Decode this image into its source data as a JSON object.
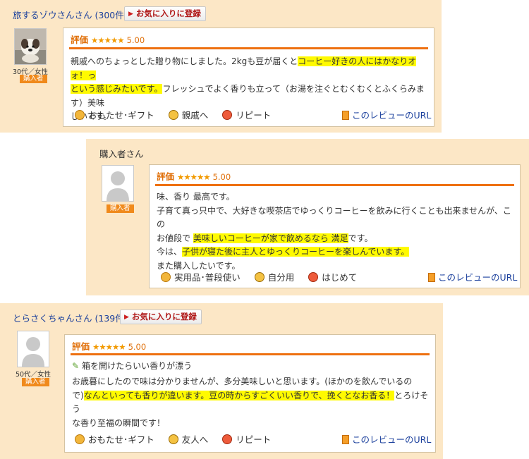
{
  "reviews": [
    {
      "reviewer": "旅するゾウさんさん",
      "count": "(300件)",
      "fav_label": "お気に入りに登録",
      "age_gender": "30代／女性",
      "badge": "購入者",
      "rating_label": "評価",
      "stars": "★★★★★",
      "score": "5.00",
      "body": [
        [
          {
            "t": "親戚へのちょっとした贈り物にしました。2kgも豆が届くと"
          },
          {
            "t": "コーヒー好きの人にはかなりオォ！っ",
            "h": true
          }
        ],
        [
          {
            "t": "という感じみたいです。",
            "h": true
          },
          {
            "t": "フレッシュでよく香りも立って（お湯を注ぐとむくむくとふくらみます）美味"
          }
        ],
        [
          {
            "t": "しいです。"
          }
        ]
      ],
      "tags": [
        {
          "icon": "hand-icon",
          "label": "おもたせ･ギフト"
        },
        {
          "icon": "person-icon",
          "label": "親戚へ"
        },
        {
          "icon": "repeat-icon",
          "label": "リピート"
        }
      ],
      "url_label": "このレビューのURL"
    },
    {
      "reviewer": "購入者さん",
      "badge": "購入者",
      "rating_label": "評価",
      "stars": "★★★★★",
      "score": "5.00",
      "body": [
        [
          {
            "t": "味、香り 最高です。"
          }
        ],
        [
          {
            "t": "子育て真っ只中で、大好きな喫茶店でゆっくりコーヒーを飲みに行くことも出来ませんが、この"
          }
        ],
        [
          {
            "t": "お値段で "
          },
          {
            "t": "美味しいコーヒーが家で飲めるなら 満足",
            "h": true
          },
          {
            "t": "です。"
          }
        ],
        [
          {
            "t": "今は、"
          },
          {
            "t": "子供が寝た後に主人とゆっくりコーヒーを楽しんでいます。",
            "h": true
          }
        ],
        [
          {
            "t": "また購入したいです。"
          }
        ]
      ],
      "tags": [
        {
          "icon": "hand-icon",
          "label": "実用品･普段使い"
        },
        {
          "icon": "person-icon",
          "label": "自分用"
        },
        {
          "icon": "repeat-icon",
          "label": "はじめて"
        }
      ],
      "url_label": "このレビューのURL"
    },
    {
      "reviewer": "とらさくちゃんさん",
      "count": "(139件)",
      "fav_label": "お気に入りに登録",
      "age_gender": "50代／女性",
      "badge": "購入者",
      "rating_label": "評価",
      "stars": "★★★★★",
      "score": "5.00",
      "title": "箱を開けたらいい香りが漂う",
      "body": [
        [
          {
            "t": "お歳暮にしたので味は分かりませんが、多分美味しいと思います。(ほかのを飲んでいるの"
          }
        ],
        [
          {
            "t": "で)"
          },
          {
            "t": "なんといっても香りが違います。豆の時からすごくいい香りで、挽くとなお香る！",
            "h": true
          },
          {
            "t": "とろけそう"
          }
        ],
        [
          {
            "t": "な香り至福の瞬間です！"
          }
        ]
      ],
      "tags": [
        {
          "icon": "hand-icon",
          "label": "おもたせ･ギフト"
        },
        {
          "icon": "person-icon",
          "label": "友人へ"
        },
        {
          "icon": "repeat-icon",
          "label": "リピート"
        }
      ],
      "url_label": "このレビューのURL"
    }
  ]
}
